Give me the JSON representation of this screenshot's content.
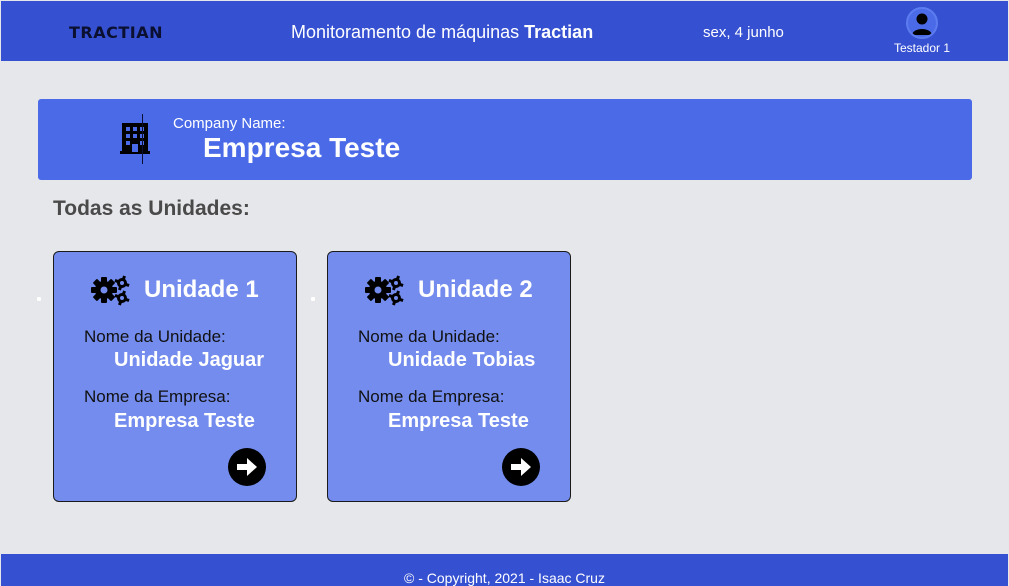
{
  "header": {
    "logo_text": "TRACTIAN",
    "title_prefix": "Monitoramento de máquinas",
    "title_brand": "Tractian",
    "date": "sex, 4 junho",
    "user": {
      "name": "Testador 1",
      "icon": "user-avatar-icon"
    }
  },
  "company": {
    "label": "Company Name:",
    "name": "Empresa Teste",
    "icon": "building-icon"
  },
  "units_section": {
    "title": "Todas as Unidades:",
    "units": [
      {
        "title": "Unidade 1",
        "unit_label": "Nome da Unidade:",
        "unit_name": "Unidade Jaguar",
        "company_label": "Nome da Empresa:",
        "company_name": "Empresa Teste",
        "icon": "gears-icon",
        "action_icon": "arrow-right-circle-icon"
      },
      {
        "title": "Unidade 2",
        "unit_label": "Nome da Unidade:",
        "unit_name": "Unidade Tobias",
        "company_label": "Nome da Empresa:",
        "company_name": "Empresa Teste",
        "icon": "gears-icon",
        "action_icon": "arrow-right-circle-icon"
      }
    ]
  },
  "footer": {
    "copyright": "© - Copyright, 2021 - Isaac Cruz"
  },
  "colors": {
    "header_bg": "#3550d1",
    "banner_bg": "#4a6ae8",
    "card_bg": "#738ced",
    "page_bg": "#e6e7ea"
  }
}
